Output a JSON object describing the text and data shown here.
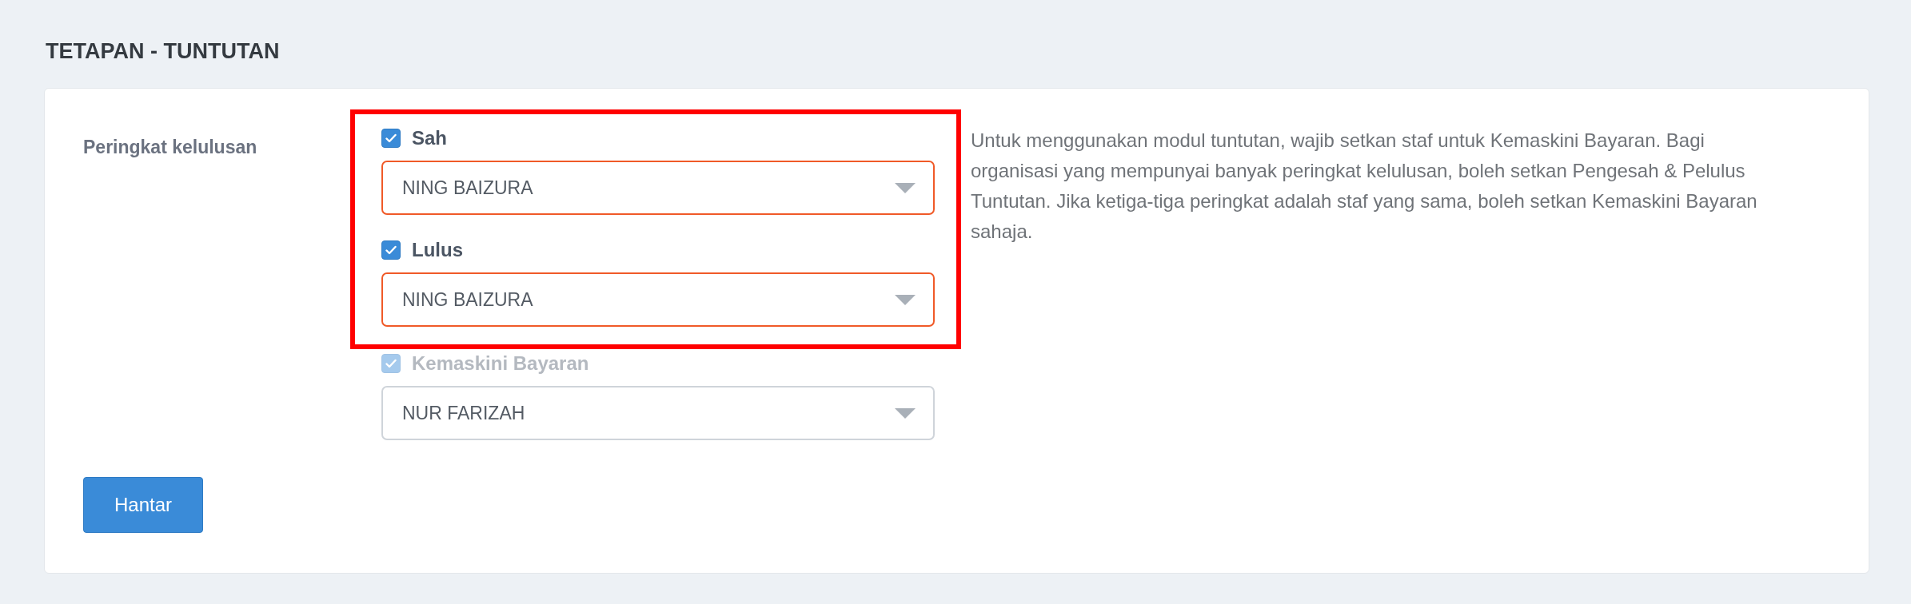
{
  "page_title": "TETAPAN - TUNTUTAN",
  "section_label": "Peringkat kelulusan",
  "levels": [
    {
      "label": "Sah",
      "checked": true,
      "disabled": false,
      "highlighted": true,
      "value": "NING BAIZURA"
    },
    {
      "label": "Lulus",
      "checked": true,
      "disabled": false,
      "highlighted": true,
      "value": "NING BAIZURA"
    },
    {
      "label": "Kemaskini Bayaran",
      "checked": true,
      "disabled": true,
      "highlighted": false,
      "value": "NUR FARIZAH"
    }
  ],
  "help_text": "Untuk menggunakan modul tuntutan, wajib setkan staf untuk Kemaskini Bayaran. Bagi organisasi yang mempunyai banyak peringkat kelulusan, boleh setkan Pengesah & Pelulus Tuntutan. Jika ketiga-tiga peringkat adalah staf yang sama, boleh setkan Kemaskini Bayaran sahaja.",
  "submit_button": "Hantar"
}
